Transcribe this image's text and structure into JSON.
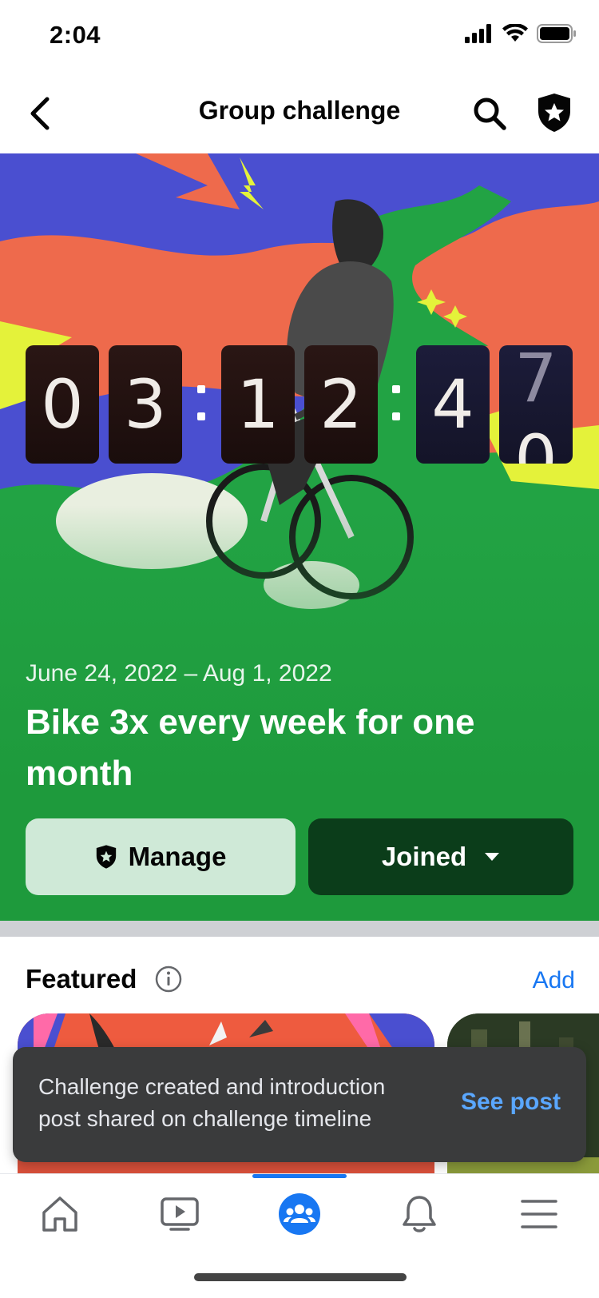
{
  "status_bar": {
    "time": "2:04"
  },
  "header": {
    "title": "Group challenge"
  },
  "countdown": {
    "digits": [
      "0",
      "3",
      "1",
      "2",
      "4",
      "7"
    ],
    "next_digit": "0"
  },
  "challenge": {
    "dates": "June 24, 2022 – Aug 1, 2022",
    "title": "Bike 3x every week for one month",
    "manage_label": "Manage",
    "joined_label": "Joined"
  },
  "featured": {
    "title": "Featured",
    "add_label": "Add"
  },
  "toast": {
    "message": "Challenge created and introduction post shared on challenge timeline",
    "action": "See post"
  },
  "tabs": [
    {
      "icon": "home-icon",
      "active": false
    },
    {
      "icon": "video-icon",
      "active": false
    },
    {
      "icon": "groups-icon",
      "active": true
    },
    {
      "icon": "bell-icon",
      "active": false
    },
    {
      "icon": "menu-icon",
      "active": false
    }
  ],
  "colors": {
    "accent": "#1877f2",
    "hero_green": "#1e9a3c",
    "joined_dark": "#0b3d1a",
    "manage_light": "#cfe9d7",
    "toast_bg": "#3a3b3c",
    "toast_link": "#5aa7ff"
  }
}
